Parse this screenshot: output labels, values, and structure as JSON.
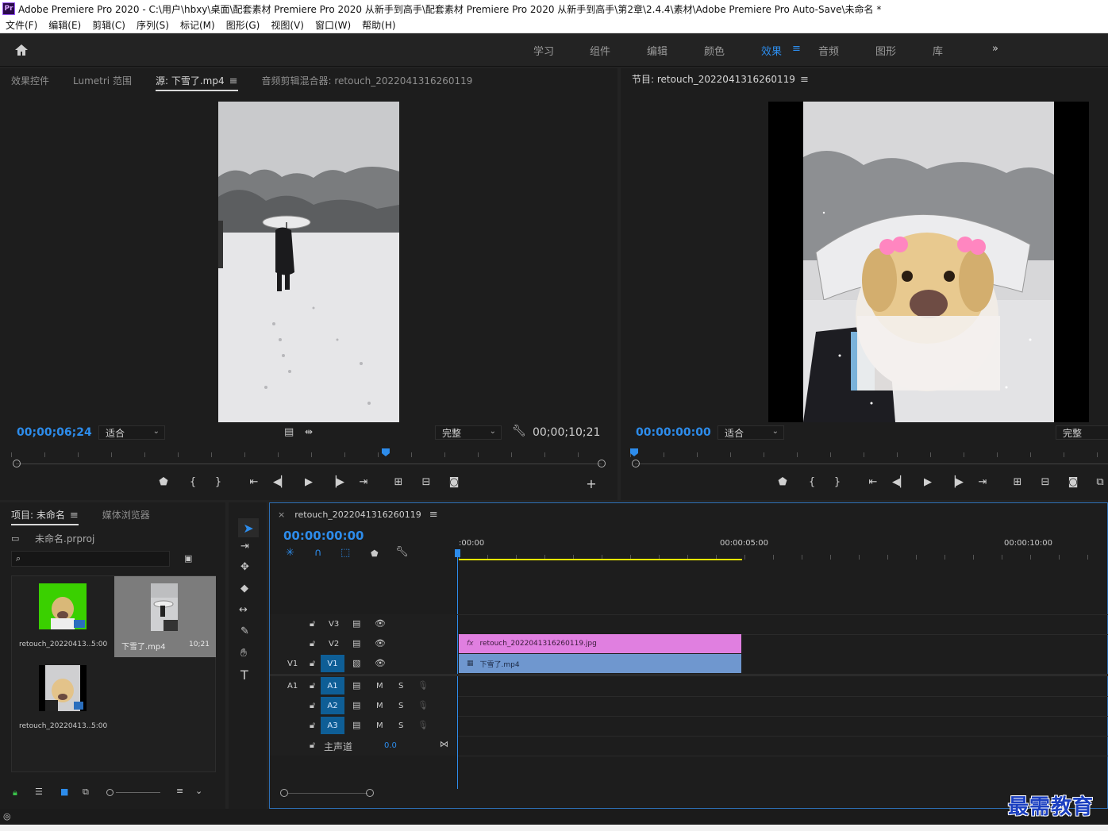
{
  "window": {
    "title": "Adobe Premiere Pro 2020 - C:\\用户\\hbxy\\桌面\\配套素材 Premiere Pro 2020 从新手到高手\\配套素材 Premiere Pro 2020 从新手到高手\\第2章\\2.4.4\\素材\\Adobe Premiere Pro Auto-Save\\未命名 *",
    "logo_text": "Pr"
  },
  "menu": [
    "文件(F)",
    "编辑(E)",
    "剪辑(C)",
    "序列(S)",
    "标记(M)",
    "图形(G)",
    "视图(V)",
    "窗口(W)",
    "帮助(H)"
  ],
  "workspaces": {
    "items": [
      "学习",
      "组件",
      "编辑",
      "颜色",
      "效果",
      "音频",
      "图形",
      "库"
    ],
    "active": "效果",
    "more": "»"
  },
  "source_panel": {
    "tabs": [
      "效果控件",
      "Lumetri 范围",
      "源: 下雪了.mp4",
      "音频剪辑混合器: retouch_2022041316260119"
    ],
    "active_tab": "源: 下雪了.mp4",
    "timecode": "00;00;06;24",
    "zoom": "适合",
    "quality": "完整",
    "duration": "00;00;10;21",
    "playhead_fraction": 0.63
  },
  "program_panel": {
    "title": "节目: retouch_2022041316260119",
    "timecode": "00:00:00:00",
    "zoom": "适合",
    "quality": "完整",
    "playhead_fraction": 0.0
  },
  "project_panel": {
    "tabs": [
      "项目: 未命名",
      "媒体浏览器"
    ],
    "active_tab": "项目: 未命名",
    "file": "未命名.prproj",
    "search_placeholder": "",
    "items": [
      {
        "name": "retouch_20220413...",
        "duration": "5:00"
      },
      {
        "name": "下雪了.mp4",
        "duration": "10;21"
      },
      {
        "name": "retouch_20220413...",
        "duration": "5:00"
      }
    ]
  },
  "timeline": {
    "close": "×",
    "sequence": "retouch_2022041316260119",
    "timecode": "00:00:00:00",
    "ruler": [
      ":00:00",
      "00:00:05:00",
      "00:00:10:00"
    ],
    "video_tracks": [
      "V3",
      "V2",
      "V1"
    ],
    "audio_tracks": [
      "A1",
      "A2",
      "A3"
    ],
    "source_v1": "V1",
    "source_a1": "A1",
    "m_label": "M",
    "s_label": "S",
    "master": {
      "label": "主声道",
      "value": "0.0"
    },
    "clips": {
      "v2": {
        "name": "retouch_2022041316260119.jpg",
        "fx": "fx",
        "color": "#e07fe0"
      },
      "v1": {
        "name": "下雪了.mp4",
        "color": "#6f97cf"
      }
    }
  },
  "watermark": "最需教育",
  "colors": {
    "accent": "#2d8ceb",
    "clip_pink": "#e07fe0",
    "clip_blue": "#6f97cf",
    "track_target": "#0e5e96"
  }
}
